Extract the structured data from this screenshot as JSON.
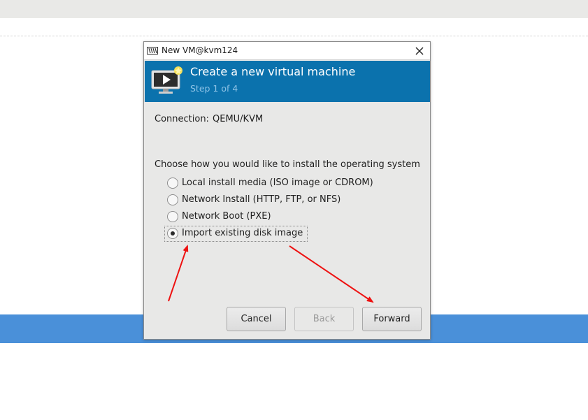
{
  "window": {
    "title": "New VM@kvm124",
    "icon": "virt-manager-icon",
    "close_icon": "close-icon"
  },
  "header": {
    "title": "Create a new virtual machine",
    "step": "Step 1 of 4",
    "icon": "vm-monitor-icon",
    "background": "#0b72ad"
  },
  "connection": {
    "label": "Connection:",
    "value": "QEMU/KVM"
  },
  "install": {
    "prompt": "Choose how you would like to install the operating system",
    "options": [
      {
        "label": "Local install media (ISO image or CDROM)",
        "selected": false
      },
      {
        "label": "Network Install (HTTP, FTP, or NFS)",
        "selected": false
      },
      {
        "label": "Network Boot (PXE)",
        "selected": false
      },
      {
        "label": "Import existing disk image",
        "selected": true
      }
    ]
  },
  "buttons": {
    "cancel": "Cancel",
    "back": "Back",
    "forward": "Forward",
    "back_enabled": false
  },
  "annotations": {
    "arrow_color": "#ee1111"
  }
}
